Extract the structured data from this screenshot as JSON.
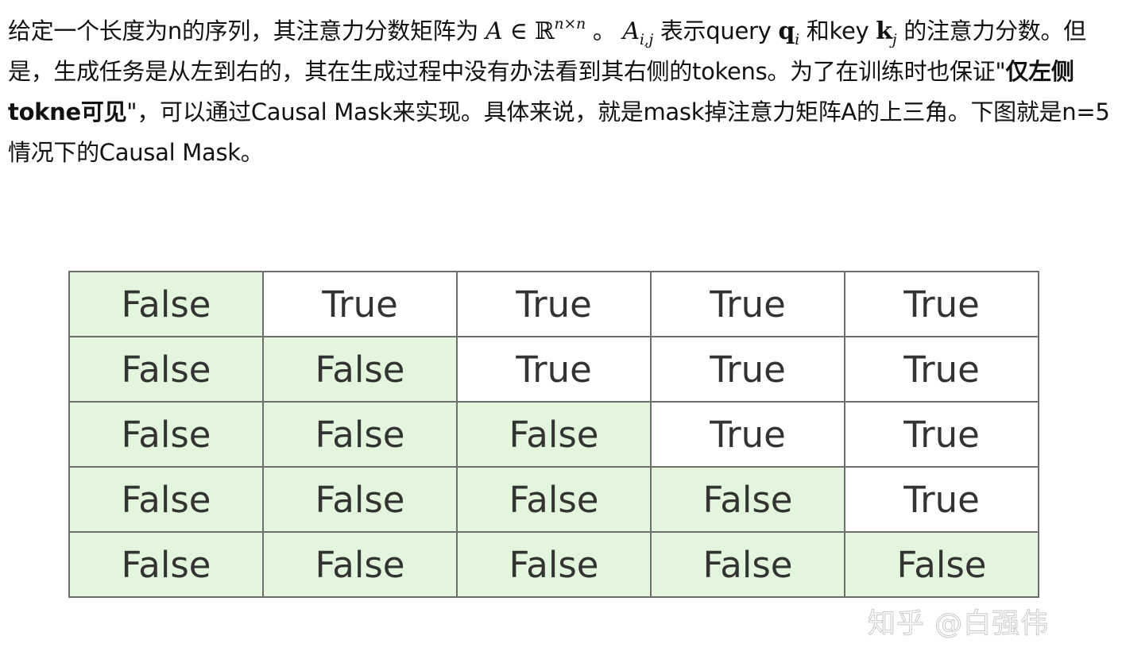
{
  "article": {
    "t1": "给定一个长度为n的序列，其注意力分数矩阵为 ",
    "m_A": "A",
    "m_in": " ∈ ",
    "m_R": "ℝ",
    "m_nxn": "n×n",
    "t2": " 。 ",
    "m_Aij_base": "A",
    "m_Aij_sub": "i,j",
    "t3": " 表示query ",
    "m_q": "q",
    "m_q_sub": "i",
    "t4": " 和key ",
    "m_k": "k",
    "m_k_sub": "j",
    "t5": " 的注意力分数。但是，生成任务是从左到右的，其在生成过程中没有办法看到其右侧的tokens。为了在训练时也保证\"",
    "bold": "仅左侧tokne可见",
    "t6": "\"，可以通过Causal Mask来实现。具体来说，就是mask掉注意力矩阵A的上三角。下图就是n=5情况下的Causal Mask。"
  },
  "table": {
    "rows": [
      [
        "False",
        "True",
        "True",
        "True",
        "True"
      ],
      [
        "False",
        "False",
        "True",
        "True",
        "True"
      ],
      [
        "False",
        "False",
        "False",
        "True",
        "True"
      ],
      [
        "False",
        "False",
        "False",
        "False",
        "True"
      ],
      [
        "False",
        "False",
        "False",
        "False",
        "False"
      ]
    ]
  },
  "colors": {
    "false_cell": "#e3f5dc",
    "true_cell": "#ffffff",
    "border": "#6e6e6e"
  },
  "watermark": "知乎 @白强伟"
}
